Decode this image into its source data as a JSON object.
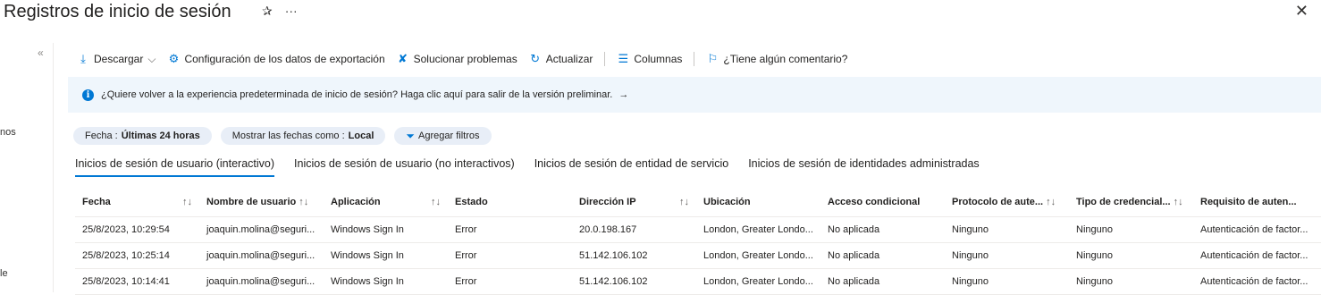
{
  "header": {
    "title": "Registros de inicio de sesión",
    "pin_glyph": "✰",
    "more_glyph": "···",
    "close_glyph": "✕"
  },
  "left_panel": {
    "collapse_glyph": "«",
    "fragment_1": "nos",
    "fragment_2": "le"
  },
  "toolbar": {
    "download": "Descargar",
    "export_settings": "Configuración de los datos de exportación",
    "troubleshoot": "Solucionar problemas",
    "refresh": "Actualizar",
    "columns": "Columnas",
    "feedback": "¿Tiene algún comentario?"
  },
  "banner": {
    "text": "¿Quiere volver a la experiencia predeterminada de inicio de sesión? Haga clic aquí para salir de la versión preliminar.",
    "arrow": "→"
  },
  "filters": {
    "date_label": "Fecha : ",
    "date_value": "Últimas 24 horas",
    "show_dates_label": "Mostrar las fechas como : ",
    "show_dates_value": "Local",
    "add_filters": "Agregar filtros"
  },
  "tabs": [
    {
      "label": "Inicios de sesión de usuario (interactivo)"
    },
    {
      "label": "Inicios de sesión de usuario (no interactivos)"
    },
    {
      "label": "Inicios de sesión de entidad de servicio"
    },
    {
      "label": "Inicios de sesión de identidades administradas"
    }
  ],
  "table": {
    "sort_glyph": "↑↓",
    "columns": [
      "Fecha",
      "Nombre de usuario",
      "Aplicación",
      "Estado",
      "Dirección IP",
      "Ubicación",
      "Acceso condicional",
      "Protocolo de aute...",
      "Tipo de credencial...",
      "Requisito de auten..."
    ],
    "rows": [
      [
        "25/8/2023, 10:29:54",
        "joaquin.molina@seguri...",
        "Windows Sign In",
        "Error",
        "20.0.198.167",
        "London, Greater Londo...",
        "No aplicada",
        "Ninguno",
        "Ninguno",
        "Autenticación de factor..."
      ],
      [
        "25/8/2023, 10:25:14",
        "joaquin.molina@seguri...",
        "Windows Sign In",
        "Error",
        "51.142.106.102",
        "London, Greater Londo...",
        "No aplicada",
        "Ninguno",
        "Ninguno",
        "Autenticación de factor..."
      ],
      [
        "25/8/2023, 10:14:41",
        "joaquin.molina@seguri...",
        "Windows Sign In",
        "Error",
        "51.142.106.102",
        "London, Greater Londo...",
        "No aplicada",
        "Ninguno",
        "Ninguno",
        "Autenticación de factor..."
      ]
    ]
  },
  "colors": {
    "accent": "#0078d4",
    "banner_bg": "#eff6fc",
    "chip_bg": "#e8eef7"
  }
}
